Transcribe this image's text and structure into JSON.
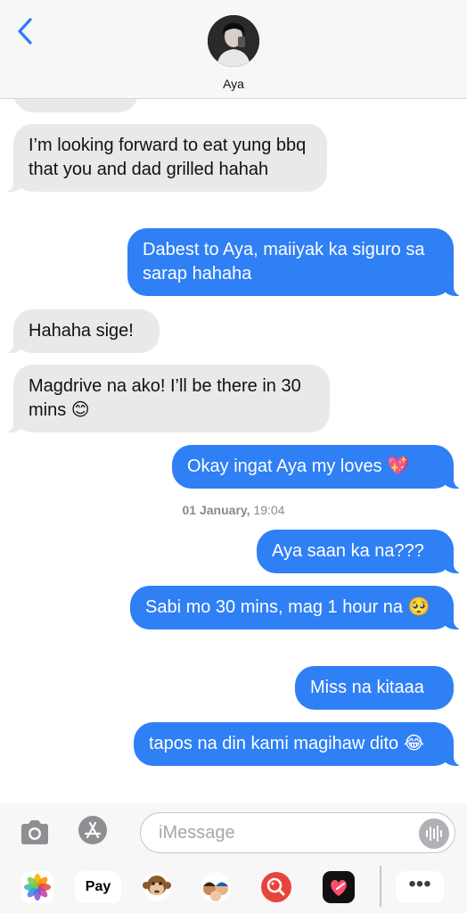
{
  "header": {
    "contact_name": "Aya",
    "back_icon": "chevron-left-icon"
  },
  "messages": [
    {
      "direction": "incoming",
      "text": "I’m looking forward to eat yung bbq that you and dad grilled hahah"
    },
    {
      "direction": "outgoing",
      "text": "Dabest to Aya, maiiyak ka siguro sa sarap hahaha"
    },
    {
      "direction": "incoming",
      "text": "Hahaha sige!"
    },
    {
      "direction": "incoming",
      "text": "Magdrive na ako! I’ll be there in 30 mins 😊"
    },
    {
      "direction": "outgoing",
      "text": "Okay ingat Aya my loves 💖"
    },
    {
      "direction": "outgoing",
      "text": "Aya saan ka na???"
    },
    {
      "direction": "outgoing",
      "text": "Sabi mo 30 mins, mag 1 hour na 🥺"
    },
    {
      "direction": "outgoing",
      "text": "Miss na kitaaa"
    },
    {
      "direction": "outgoing",
      "text": "tapos na din kami magihaw dito 😂"
    }
  ],
  "timestamp": {
    "date": "01 January,",
    "time": "19:04"
  },
  "input": {
    "placeholder": "iMessage",
    "value": ""
  },
  "app_drawer": {
    "apple_pay_label": "Pay",
    "more_label": "•••",
    "icons": [
      "photos-icon",
      "apple-pay-icon",
      "memoji-monkey-icon",
      "memoji-stickers-icon",
      "image-search-icon",
      "digital-touch-icon",
      "more-icon"
    ]
  },
  "colors": {
    "outgoing_bubble": "#2f7ff5",
    "incoming_bubble": "#e9e9eb",
    "accent": "#007aff"
  }
}
